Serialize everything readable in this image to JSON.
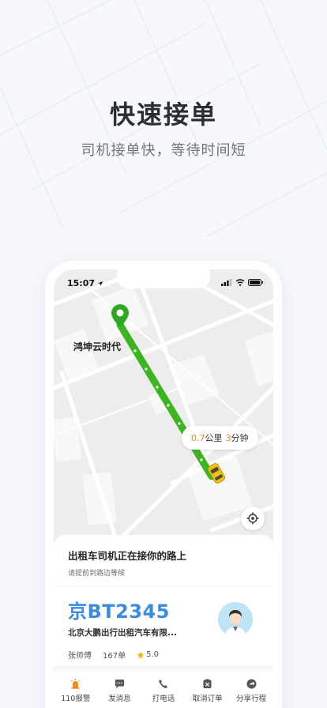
{
  "hero": {
    "title": "快速接单",
    "subtitle": "司机接单快，等待时间短"
  },
  "status_bar": {
    "time": "15:07"
  },
  "map": {
    "place_label": "鸿坤云时代",
    "eta": {
      "distance": "0.7",
      "distance_unit": "公里",
      "minutes": "3",
      "minutes_unit": "分钟"
    },
    "route_color": "#3cb520"
  },
  "status_card": {
    "title": "出租车司机正在接你的路上",
    "subtitle": "请提前到路边等候"
  },
  "driver_card": {
    "plate": "京BT2345",
    "company": "北京大鹏出行出租汽车有限...",
    "driver_name": "张师傅",
    "orders": "167单",
    "rating": "5.0"
  },
  "actions": [
    {
      "label": "110报警",
      "icon": "alarm-icon"
    },
    {
      "label": "发消息",
      "icon": "message-icon"
    },
    {
      "label": "打电话",
      "icon": "phone-icon"
    },
    {
      "label": "取消订单",
      "icon": "cancel-order-icon"
    },
    {
      "label": "分享行程",
      "icon": "share-icon"
    }
  ],
  "colors": {
    "plate_blue": "#3a8ce0",
    "eta_orange": "#f08a1c",
    "alarm_orange": "#f08a1c",
    "star_yellow": "#f5b400"
  }
}
